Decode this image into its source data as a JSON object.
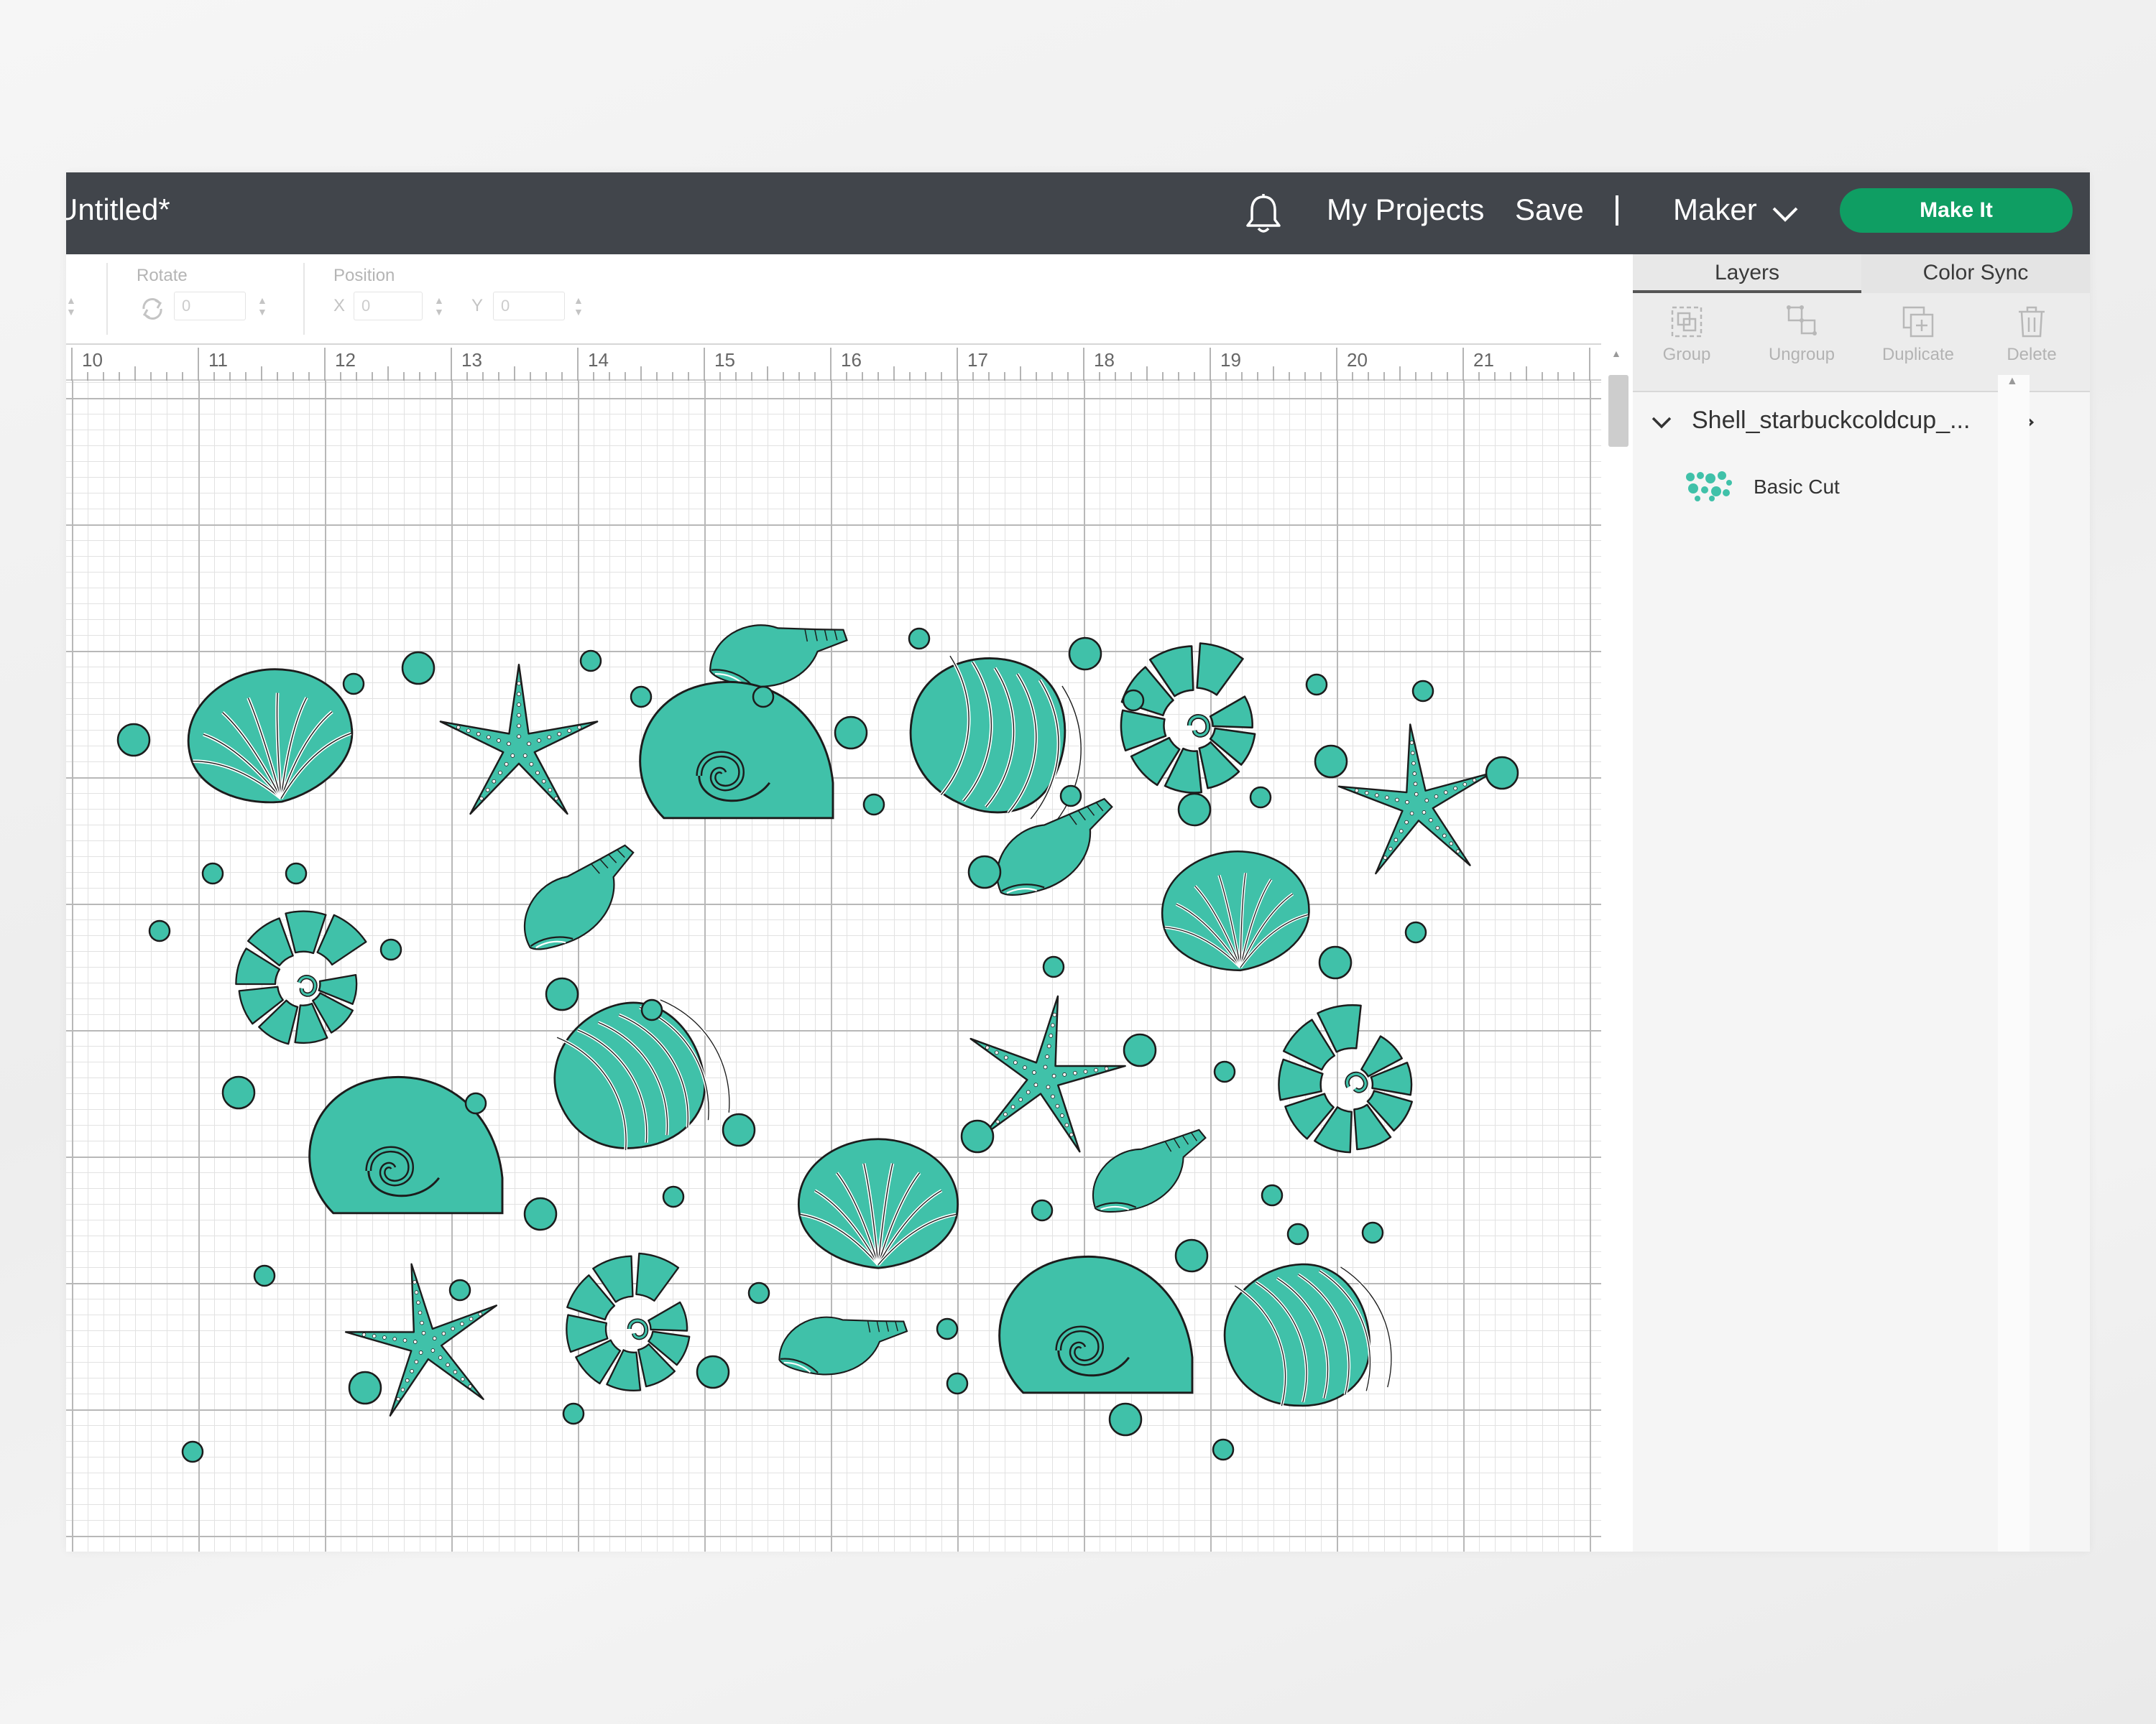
{
  "header": {
    "title": "Untitled*",
    "my_projects": "My Projects",
    "save": "Save",
    "separator": "|",
    "machine": "Maker",
    "make_it": "Make It"
  },
  "toolbar": {
    "rotate_label": "Rotate",
    "rotate_value": "0",
    "position_label": "Position",
    "x_label": "X",
    "x_value": "0",
    "y_label": "Y",
    "y_value": "0"
  },
  "ruler": {
    "numbers": [
      "10",
      "11",
      "12",
      "13",
      "14",
      "15",
      "16",
      "17",
      "18",
      "19",
      "20",
      "21"
    ]
  },
  "panel": {
    "tabs": [
      "Layers",
      "Color Sync"
    ],
    "actions": [
      "Group",
      "Ungroup",
      "Duplicate",
      "Delete"
    ],
    "layer_name": "Shell_starbuckcoldcup_...",
    "sublayer_name": "Basic Cut"
  },
  "colors": {
    "header_bg": "#41454b",
    "make_it_green": "#0f9e63",
    "design_fill": "#40c1a9",
    "outline": "#1c1c1c"
  },
  "icons": {
    "bell": "bell-icon",
    "chevron": "chevron-down-icon",
    "eye": "eye-icon",
    "group": "group-icon",
    "ungroup": "ungroup-icon",
    "duplicate": "duplicate-icon",
    "delete": "trash-icon"
  }
}
